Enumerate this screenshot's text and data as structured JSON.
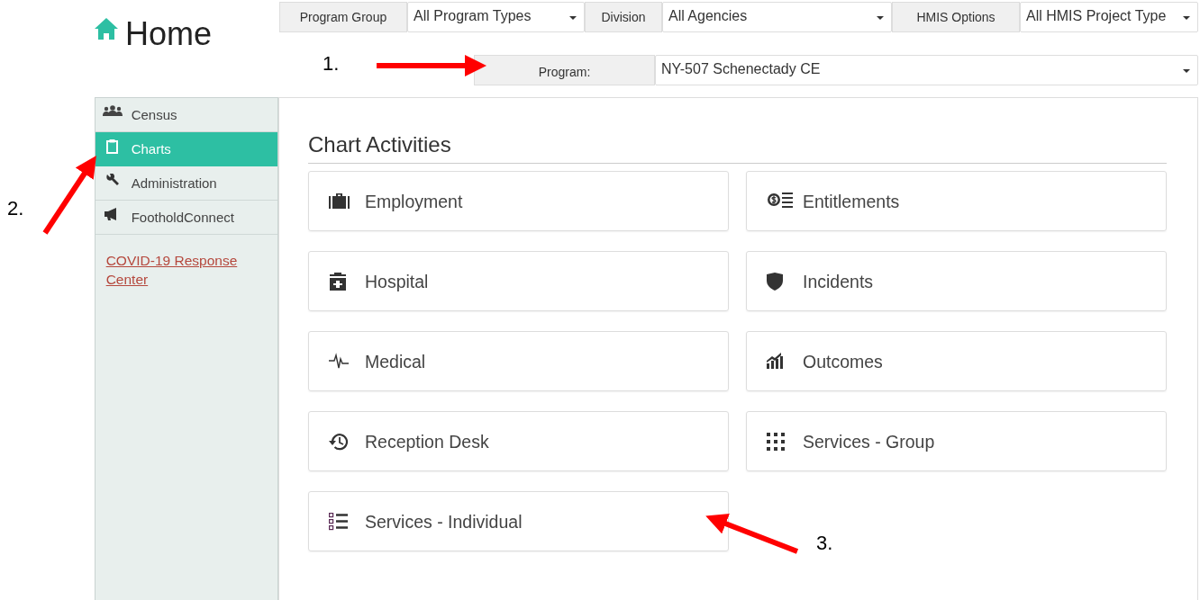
{
  "header": {
    "title": "Home"
  },
  "filters": [
    {
      "label": "Program Group",
      "value": "All Program Types"
    },
    {
      "label": "Division",
      "value": "All Agencies"
    },
    {
      "label": "HMIS Options",
      "value": "All HMIS Project Type"
    }
  ],
  "program": {
    "label": "Program:",
    "value": "NY-507 Schenectady CE"
  },
  "sidebar": {
    "items": [
      {
        "label": "Census",
        "selected": false
      },
      {
        "label": "Charts",
        "selected": true
      },
      {
        "label": "Administration",
        "selected": false
      },
      {
        "label": "FootholdConnect",
        "selected": false
      }
    ],
    "link": "COVID-19 Response Center"
  },
  "main": {
    "heading": "Chart Activities",
    "activities": [
      {
        "label": "Employment"
      },
      {
        "label": "Entitlements"
      },
      {
        "label": "Hospital"
      },
      {
        "label": "Incidents"
      },
      {
        "label": "Medical"
      },
      {
        "label": "Outcomes"
      },
      {
        "label": "Reception Desk"
      },
      {
        "label": "Services - Group"
      },
      {
        "label": "Services - Individual"
      }
    ]
  },
  "annotations": [
    {
      "label": "1."
    },
    {
      "label": "2."
    },
    {
      "label": "3."
    }
  ]
}
